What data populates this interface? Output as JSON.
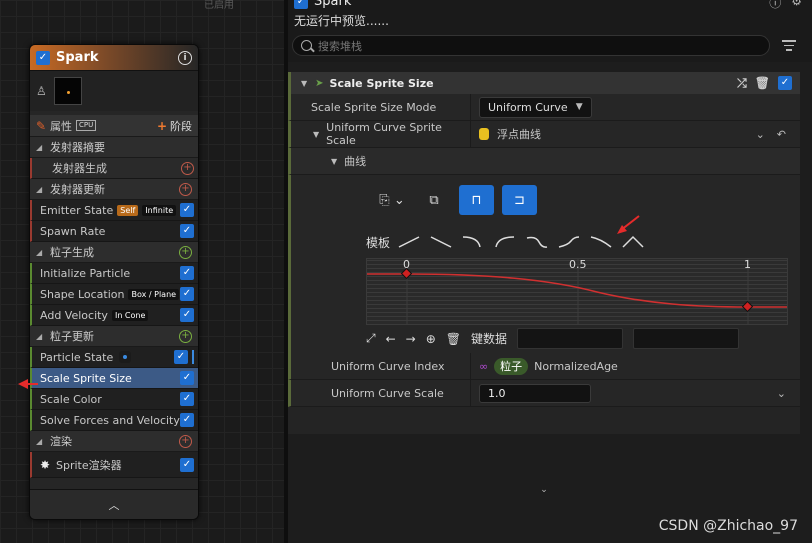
{
  "graph": {
    "top_label": "已启用"
  },
  "node": {
    "title": "Spark",
    "properties_label": "属性",
    "cpu_badge": "CPU",
    "stage_button": "阶段",
    "emitter_summary": "发射器摘要",
    "emitter_spawn": "发射器生成",
    "emitter_update": "发射器更新",
    "emitter_state": "Emitter State",
    "emitter_state_tag1": "Self",
    "emitter_state_tag2": "Infinite",
    "spawn_rate": "Spawn Rate",
    "particle_spawn": "粒子生成",
    "initialize_particle": "Initialize Particle",
    "shape_location": "Shape Location",
    "shape_location_tag": "Box / Plane",
    "add_velocity": "Add Velocity",
    "add_velocity_tag": "In Cone",
    "particle_update": "粒子更新",
    "particle_state": "Particle State",
    "scale_sprite_size": "Scale Sprite Size",
    "scale_color": "Scale Color",
    "solve_forces": "Solve Forces and Velocity",
    "render": "渲染",
    "sprite_renderer": "Sprite渲染器"
  },
  "panel": {
    "title": "Spark",
    "preview_text": "无运行中预览......",
    "search_placeholder": "搜索堆栈",
    "category": "Scale Sprite Size",
    "mode_label": "Scale Sprite Size Mode",
    "mode_value": "Uniform Curve",
    "curve_scale_label": "Uniform Curve Sprite Scale",
    "curve_scale_value": "浮点曲线",
    "curve_label": "曲线",
    "template_label": "模板",
    "axis_ticks": [
      "0",
      "0.5",
      "1"
    ],
    "key_data_label": "键数据",
    "index_label": "Uniform Curve Index",
    "index_chip": "粒子",
    "index_value": "NormalizedAge",
    "scale_label": "Uniform Curve Scale",
    "scale_value": "1.0"
  },
  "watermark": "CSDN @Zhichao_97",
  "colors": {
    "accent_blue": "#1f6fd1",
    "curve_red": "#d03030",
    "selected_row": "#3c5a86"
  }
}
